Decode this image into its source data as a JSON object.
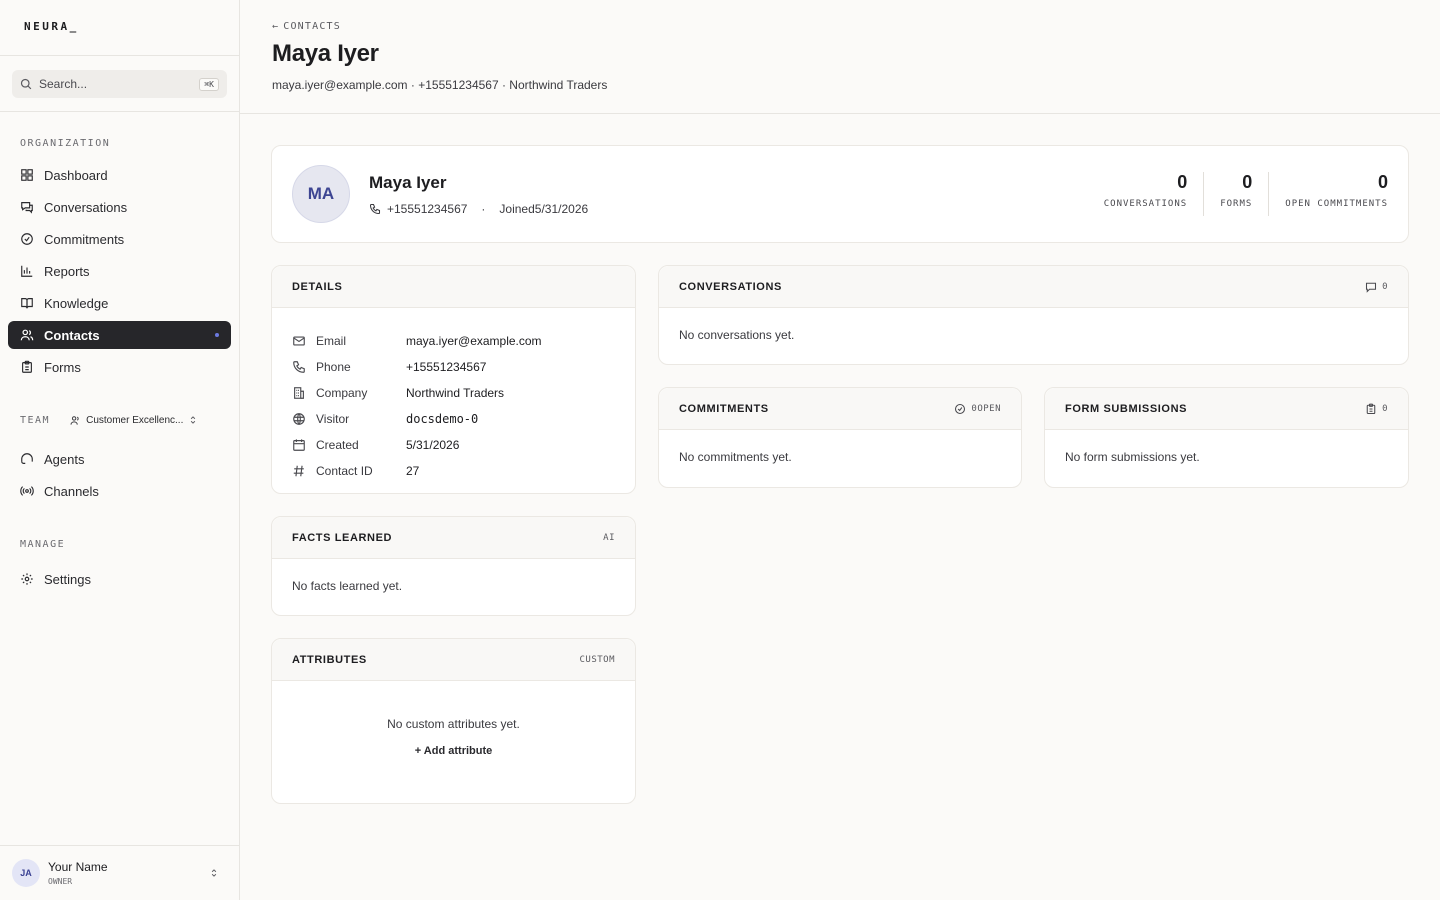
{
  "brand": {
    "logo": "NEURA_"
  },
  "search": {
    "placeholder": "Search...",
    "shortcut": "⌘K"
  },
  "sidebar": {
    "org_label": "ORGANIZATION",
    "org_items": [
      {
        "label": "Dashboard",
        "icon": "grid-icon"
      },
      {
        "label": "Conversations",
        "icon": "chat-icon"
      },
      {
        "label": "Commitments",
        "icon": "check-circle-icon"
      },
      {
        "label": "Reports",
        "icon": "bar-chart-icon"
      },
      {
        "label": "Knowledge",
        "icon": "book-icon"
      },
      {
        "label": "Contacts",
        "icon": "users-icon",
        "active": true
      },
      {
        "label": "Forms",
        "icon": "clipboard-icon"
      }
    ],
    "team_label": "TEAM",
    "team_name": "Customer Excellenc...",
    "team_items": [
      {
        "label": "Agents",
        "icon": "robot-icon"
      },
      {
        "label": "Channels",
        "icon": "broadcast-icon"
      }
    ],
    "manage_label": "MANAGE",
    "manage_items": [
      {
        "label": "Settings",
        "icon": "gear-icon"
      }
    ]
  },
  "user": {
    "initials": "JA",
    "name": "Your Name",
    "role": "OWNER"
  },
  "header": {
    "back_label": "CONTACTS",
    "title": "Maya Iyer",
    "subline": "maya.iyer@example.com · +15551234567 · Northwind Traders"
  },
  "profile": {
    "initials": "MA",
    "name": "Maya Iyer",
    "phone": "+15551234567",
    "joined": "Joined5/31/2026",
    "stats": [
      {
        "value": "0",
        "label": "CONVERSATIONS"
      },
      {
        "value": "0",
        "label": "FORMS"
      },
      {
        "value": "0",
        "label": "OPEN COMMITMENTS"
      }
    ]
  },
  "details": {
    "title": "DETAILS",
    "rows": [
      {
        "label": "Email",
        "value": "maya.iyer@example.com",
        "icon": "mail-icon"
      },
      {
        "label": "Phone",
        "value": "+15551234567",
        "icon": "phone-icon"
      },
      {
        "label": "Company",
        "value": "Northwind Traders",
        "icon": "building-icon"
      },
      {
        "label": "Visitor",
        "value": "docsdemo-0",
        "icon": "globe-icon"
      },
      {
        "label": "Created",
        "value": "5/31/2026",
        "icon": "calendar-icon"
      },
      {
        "label": "Contact ID",
        "value": "27",
        "icon": "hash-icon"
      }
    ]
  },
  "facts": {
    "title": "FACTS LEARNED",
    "tag": "AI",
    "empty": "No facts learned yet."
  },
  "attributes": {
    "title": "ATTRIBUTES",
    "tag": "CUSTOM",
    "empty": "No custom attributes yet.",
    "add_label": "+ Add attribute"
  },
  "conversations": {
    "title": "CONVERSATIONS",
    "count": "0",
    "empty": "No conversations yet."
  },
  "commitments": {
    "title": "COMMITMENTS",
    "count": "0OPEN",
    "empty": "No commitments yet."
  },
  "form_submissions": {
    "title": "FORM SUBMISSIONS",
    "count": "0",
    "empty": "No form submissions yet."
  },
  "colors": {
    "accent": "#3d4592",
    "active_nav_bg": "#26262a",
    "background": "#fbfaf8"
  }
}
